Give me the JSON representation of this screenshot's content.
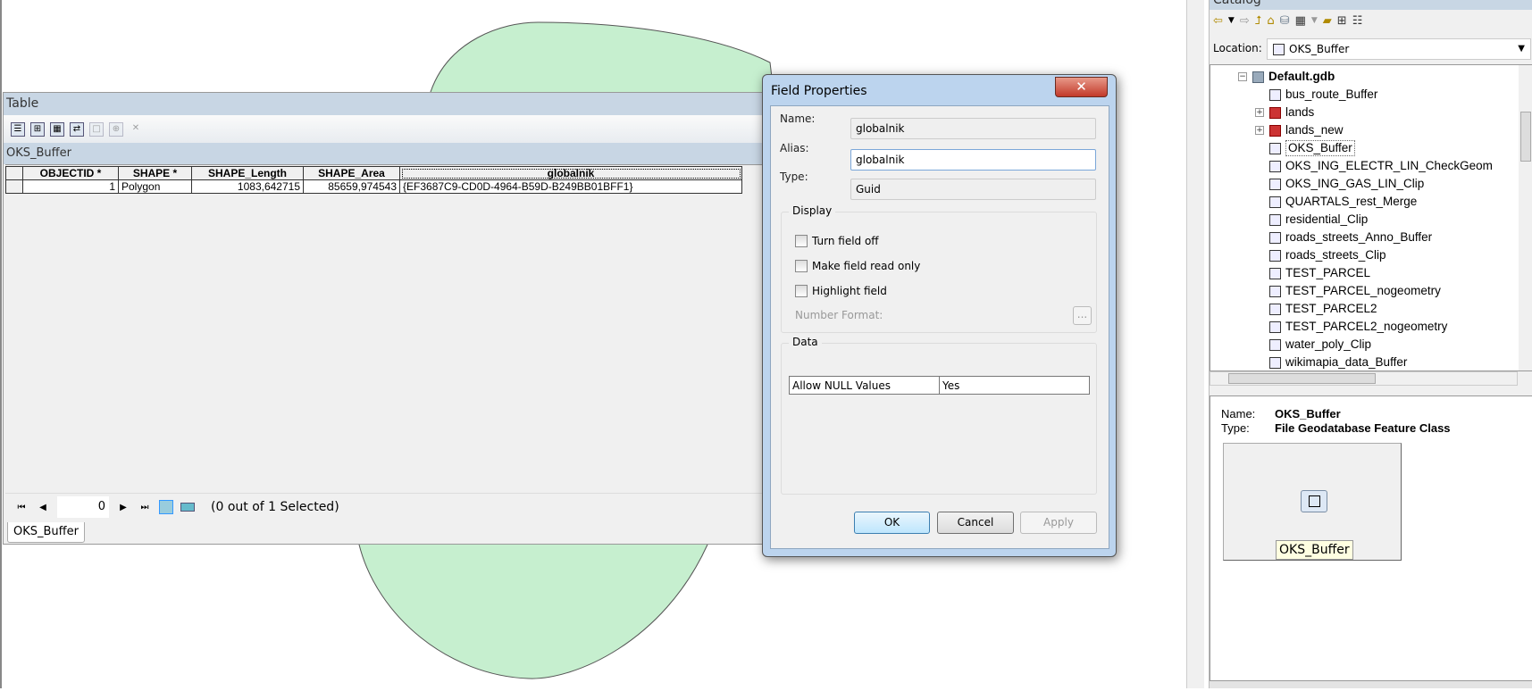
{
  "colors": {
    "buffer_fill": "#c6efcf",
    "title_bar": "#c8d6e4",
    "close": "#c2392a"
  },
  "table_window": {
    "title": "Table",
    "toolbar_icons": [
      "table-options-icon",
      "related-tables-icon",
      "select-by-attributes-icon",
      "switch-selection-icon",
      "clear-selection-icon",
      "zoom-to-selected-icon",
      "delete-selected-icon"
    ],
    "layer_name": "OKS_Buffer",
    "columns": [
      "OBJECTID *",
      "SHAPE *",
      "SHAPE_Length",
      "SHAPE_Area",
      "globalnik"
    ],
    "rows": [
      [
        "1",
        "Polygon",
        "1083,642715",
        "85659,974543",
        "{EF3687C9-CD0D-4964-B59D-B249BB01BFF1}"
      ]
    ],
    "record_number": "0",
    "selection_status": "(0 out of 1 Selected)",
    "tab": "OKS_Buffer"
  },
  "dialog": {
    "title": "Field Properties",
    "close": "✕",
    "name_label": "Name:",
    "name_value": "globalnik",
    "alias_label": "Alias:",
    "alias_value": "globalnik",
    "type_label": "Type:",
    "type_value": "Guid",
    "display_group": "Display",
    "checkboxes": [
      {
        "label": "Turn field off",
        "checked": false
      },
      {
        "label": "Make field read only",
        "checked": false
      },
      {
        "label": "Highlight field",
        "checked": false
      }
    ],
    "number_format_label": "Number Format:",
    "ellipsis": "...",
    "data_group": "Data",
    "data_rows": [
      [
        "Allow NULL Values",
        "Yes"
      ]
    ],
    "ok": "OK",
    "cancel": "Cancel",
    "apply": "Apply"
  },
  "catalog": {
    "title": "Catalog",
    "location_label": "Location:",
    "location_value": "OKS_Buffer",
    "root": "Default.gdb",
    "items": [
      {
        "label": "bus_route_Buffer",
        "icon": "polygon-feature-class-icon"
      },
      {
        "label": "lands",
        "icon": "feature-dataset-icon",
        "expandable": true
      },
      {
        "label": "lands_new",
        "icon": "feature-dataset-icon",
        "expandable": true
      },
      {
        "label": "OKS_Buffer",
        "icon": "polygon-feature-class-icon",
        "selected": true
      },
      {
        "label": "OKS_ING_ELECTR_LIN_CheckGeom",
        "icon": "table-icon"
      },
      {
        "label": "OKS_ING_GAS_LIN_Clip",
        "icon": "line-feature-class-icon"
      },
      {
        "label": "QUARTALS_rest_Merge",
        "icon": "polygon-feature-class-icon"
      },
      {
        "label": "residential_Clip",
        "icon": "polygon-feature-class-icon"
      },
      {
        "label": "roads_streets_Anno_Buffer",
        "icon": "polygon-feature-class-icon"
      },
      {
        "label": "roads_streets_Clip",
        "icon": "line-feature-class-icon"
      },
      {
        "label": "TEST_PARCEL",
        "icon": "polygon-feature-class-icon"
      },
      {
        "label": "TEST_PARCEL_nogeometry",
        "icon": "table-icon"
      },
      {
        "label": "TEST_PARCEL2",
        "icon": "polygon-feature-class-icon"
      },
      {
        "label": "TEST_PARCEL2_nogeometry",
        "icon": "table-icon"
      },
      {
        "label": "water_poly_Clip",
        "icon": "polygon-feature-class-icon"
      },
      {
        "label": "wikimapia_data_Buffer",
        "icon": "polygon-feature-class-icon"
      }
    ],
    "preview": {
      "name_label": "Name:",
      "name_value": "OKS_Buffer",
      "type_label": "Type:",
      "type_value": "File Geodatabase Feature Class",
      "thumb_label": "OKS_Buffer"
    }
  }
}
